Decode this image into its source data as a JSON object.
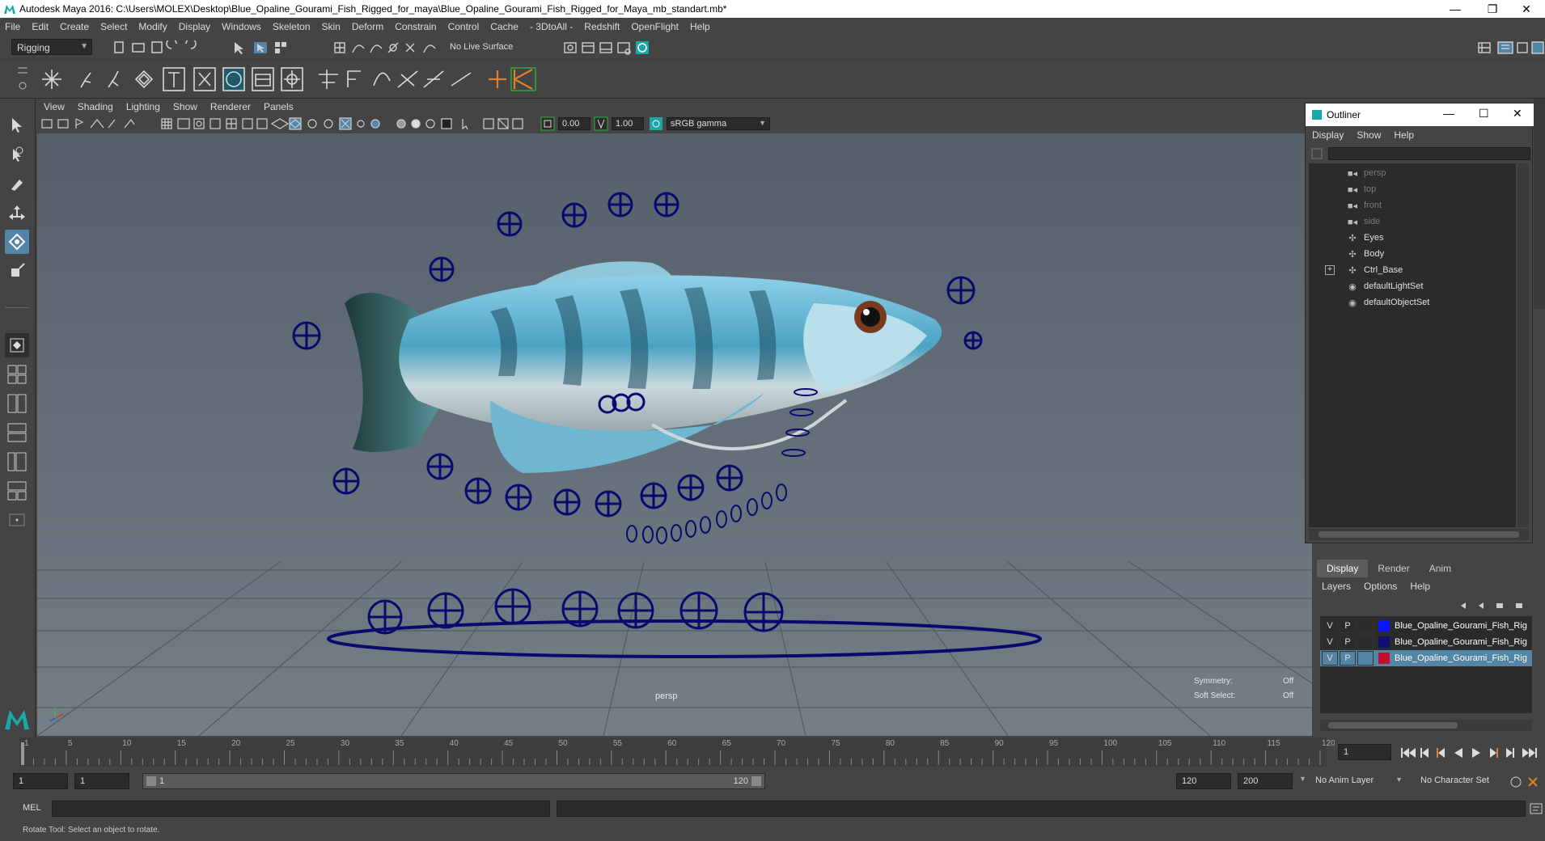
{
  "window": {
    "title": "Autodesk Maya 2016: C:\\Users\\MOLEX\\Desktop\\Blue_Opaline_Gourami_Fish_Rigged_for_maya\\Blue_Opaline_Gourami_Fish_Rigged_for_Maya_mb_standart.mb*",
    "minimize": "—",
    "restore": "❐",
    "close": "✕"
  },
  "menubar": [
    "File",
    "Edit",
    "Create",
    "Select",
    "Modify",
    "Display",
    "Windows",
    "Skeleton",
    "Skin",
    "Deform",
    "Constrain",
    "Control",
    "Cache",
    "- 3DtoAll -",
    "Redshift",
    "OpenFlight",
    "Help"
  ],
  "status": {
    "menuset": "Rigging",
    "live_surface": "No Live Surface"
  },
  "viewport": {
    "menu": [
      "View",
      "Shading",
      "Lighting",
      "Show",
      "Renderer",
      "Panels"
    ],
    "exposure": "0.00",
    "gamma": "1.00",
    "color_space": "sRGB gamma",
    "camera_label": "persp",
    "symmetry_label": "Symmetry:",
    "symmetry_value": "Off",
    "soft_select_label": "Soft Select:",
    "soft_select_value": "Off"
  },
  "outliner": {
    "title": "Outliner",
    "menu": [
      "Display",
      "Show",
      "Help"
    ],
    "items": [
      {
        "label": "persp",
        "icon": "camera-icon",
        "dim": true
      },
      {
        "label": "top",
        "icon": "camera-icon",
        "dim": true
      },
      {
        "label": "front",
        "icon": "camera-icon",
        "dim": true
      },
      {
        "label": "side",
        "icon": "camera-icon",
        "dim": true
      },
      {
        "label": "Eyes",
        "icon": "transform-icon",
        "dim": false
      },
      {
        "label": "Body",
        "icon": "transform-icon",
        "dim": false
      },
      {
        "label": "Ctrl_Base",
        "icon": "transform-icon",
        "dim": false,
        "expandable": true
      },
      {
        "label": "defaultLightSet",
        "icon": "set-icon",
        "dim": false
      },
      {
        "label": "defaultObjectSet",
        "icon": "set-icon",
        "dim": false
      }
    ]
  },
  "layers": {
    "tabs": [
      "Display",
      "Render",
      "Anim"
    ],
    "menu": [
      "Layers",
      "Options",
      "Help"
    ],
    "rows": [
      {
        "v": "V",
        "p": "P",
        "color": "#0a14ff",
        "name": "Blue_Opaline_Gourami_Fish_Rig",
        "selected": false
      },
      {
        "v": "V",
        "p": "P",
        "color": "#101070",
        "name": "Blue_Opaline_Gourami_Fish_Rig",
        "selected": false
      },
      {
        "v": "V",
        "p": "P",
        "color": "#c01030",
        "name": "Blue_Opaline_Gourami_Fish_Rig",
        "selected": true
      }
    ]
  },
  "timeline": {
    "ticks": [
      "1",
      "5",
      "10",
      "15",
      "20",
      "25",
      "30",
      "35",
      "40",
      "45",
      "50",
      "55",
      "60",
      "65",
      "70",
      "75",
      "80",
      "85",
      "90",
      "95",
      "100",
      "105",
      "110",
      "115",
      "120"
    ],
    "current_frame": "1"
  },
  "range": {
    "start": "1",
    "playback_start": "1",
    "slider_start": "1",
    "slider_end": "120",
    "playback_end": "120",
    "end": "200",
    "anim_layer": "No Anim Layer",
    "character_set": "No Character Set"
  },
  "cmdline": {
    "label": "MEL"
  },
  "helpline": {
    "text": "Rotate Tool: Select an object to rotate."
  },
  "colors": {
    "control_curve": "#0a0a6e",
    "fish_body": "#6ab8d4",
    "accent": "#5285a6"
  }
}
